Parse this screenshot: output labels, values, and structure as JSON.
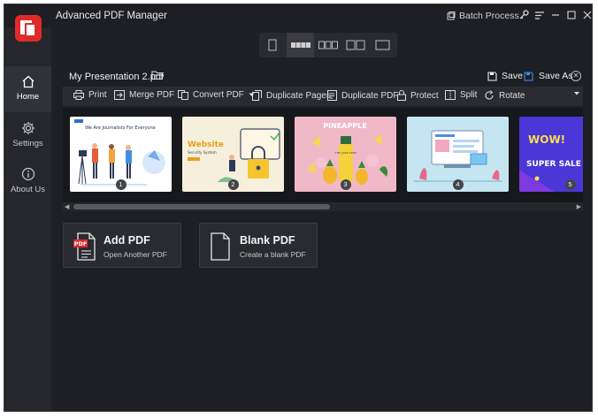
{
  "app": {
    "title": "Advanced PDF Manager"
  },
  "titlebar": {
    "batch_label": "Batch Process"
  },
  "sidebar": {
    "items": [
      {
        "label": "Home"
      },
      {
        "label": "Settings"
      },
      {
        "label": "About Us"
      }
    ]
  },
  "document": {
    "name": "My Presentation 2.pdf",
    "save_label": "Save",
    "save_as_label": "Save As"
  },
  "toolbar": {
    "items": [
      {
        "label": "Print"
      },
      {
        "label": "Merge PDF"
      },
      {
        "label": "Convert PDF"
      },
      {
        "label": "Duplicate Pages"
      },
      {
        "label": "Duplicate PDF"
      },
      {
        "label": "Protect"
      },
      {
        "label": "Split"
      },
      {
        "label": "Rotate"
      }
    ]
  },
  "pages": [
    {
      "number": "1",
      "headline": "We Are Journalists For Everyone"
    },
    {
      "number": "2",
      "headline": "Website",
      "subline": "Security System"
    },
    {
      "number": "3",
      "headline": "PINEAPPLE",
      "subline": "THE JUICE SHOP"
    },
    {
      "number": "4"
    },
    {
      "number": "5",
      "headline": "WOW!",
      "subline": "SUPER SALE"
    }
  ],
  "cards": [
    {
      "title": "Add PDF",
      "subtitle": "Open Another PDF",
      "badge": "PDF"
    },
    {
      "title": "Blank PDF",
      "subtitle": "Create a blank PDF"
    }
  ],
  "colors": {
    "accent": "#e02a2a",
    "background": "#1e1f24",
    "sidebar": "#26272c"
  }
}
